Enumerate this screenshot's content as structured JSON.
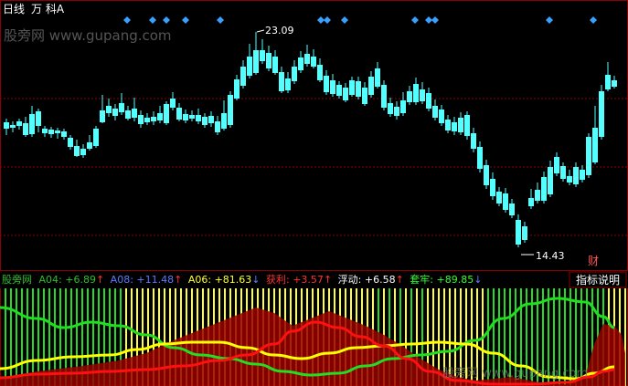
{
  "header": {
    "period_label": "日线",
    "stock_label": "万 科A"
  },
  "watermark_top": "股旁网 www.gupang.com",
  "watermark_bottom": "股旁网 www.gupang.com",
  "price_annotations": {
    "high": "23.09",
    "low": "14.43"
  },
  "financial_marker": "财",
  "indicator_bar": {
    "source": "股旁网",
    "items": [
      {
        "label": "A04: ",
        "value": "+6.89",
        "arrow": "↑",
        "color": "#2ebf2e"
      },
      {
        "label": "A08: ",
        "value": "+11.48",
        "arrow": "↑",
        "color": "#5b7cff"
      },
      {
        "label": "A06: ",
        "value": "+81.63",
        "arrow": "↓",
        "color": "#ffff33"
      },
      {
        "label": "获利: ",
        "value": "+3.57",
        "arrow": "↑",
        "color": "#ff3333"
      },
      {
        "label": "浮动: ",
        "value": "+6.58",
        "arrow": "↑",
        "color": "#ffffff"
      },
      {
        "label": "套牢: ",
        "value": "+89.85",
        "arrow": "↓",
        "color": "#33ff33"
      }
    ],
    "help_button": "指标说明"
  },
  "colors": {
    "up": "#ff3333",
    "down": "#54ffff",
    "diamond": "#3aa0ff",
    "grid": "#8b0000",
    "green_line": "#22dd22",
    "yellow_line": "#ffff00",
    "red_line": "#ff1010",
    "green_bar": "#22dd22",
    "yellow_bar": "#ffff33",
    "dark_red_area": "#990000"
  },
  "icons": {
    "signal_markers": "diamond-icon"
  }
}
